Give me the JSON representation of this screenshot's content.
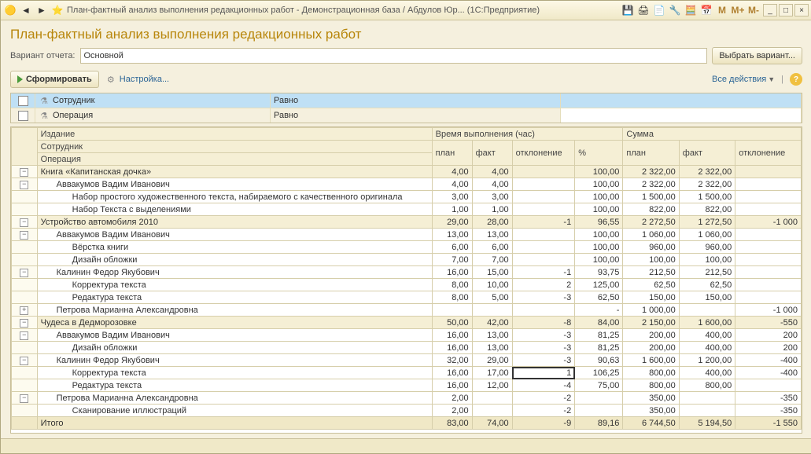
{
  "titlebar": {
    "title": "План-фактный анализ выполнения редакционных работ - Демонстрационная база / Абдулов Юр...  (1С:Предприятие)"
  },
  "page_title": "План-фактный анализ выполнения редакционных работ",
  "variant": {
    "label": "Вариант отчета:",
    "value": "Основной",
    "choose_btn": "Выбрать вариант..."
  },
  "toolbar": {
    "form": "Сформировать",
    "settings": "Настройка...",
    "all_actions": "Все действия"
  },
  "filters": [
    {
      "name": "Сотрудник",
      "op": "Равно",
      "selected": true
    },
    {
      "name": "Операция",
      "op": "Равно",
      "selected": false
    }
  ],
  "headers": {
    "group1": "Издание",
    "group2": "Сотрудник",
    "group3": "Операция",
    "time": "Время выполнения (час)",
    "sum": "Сумма",
    "plan": "план",
    "fact": "факт",
    "dev": "отклонение",
    "pct": "%"
  },
  "rows": [
    {
      "lvl": 0,
      "exp": "-",
      "label": "Книга «Капитанская дочка»",
      "p": "4,00",
      "f": "4,00",
      "d": "",
      "pc": "100,00",
      "sp": "2 322,00",
      "sf": "2 322,00",
      "sd": ""
    },
    {
      "lvl": 1,
      "exp": "-",
      "label": "Аввакумов Вадим Иванович",
      "p": "4,00",
      "f": "4,00",
      "d": "",
      "pc": "100,00",
      "sp": "2 322,00",
      "sf": "2 322,00",
      "sd": ""
    },
    {
      "lvl": 2,
      "exp": "",
      "label": "Набор простого художественного текста, набираемого с качественного оригинала",
      "p": "3,00",
      "f": "3,00",
      "d": "",
      "pc": "100,00",
      "sp": "1 500,00",
      "sf": "1 500,00",
      "sd": ""
    },
    {
      "lvl": 2,
      "exp": "",
      "label": "Набор Текста с выделениями",
      "p": "1,00",
      "f": "1,00",
      "d": "",
      "pc": "100,00",
      "sp": "822,00",
      "sf": "822,00",
      "sd": ""
    },
    {
      "lvl": 0,
      "exp": "-",
      "label": "Устройство автомобиля 2010",
      "p": "29,00",
      "f": "28,00",
      "d": "-1",
      "pc": "96,55",
      "sp": "2 272,50",
      "sf": "1 272,50",
      "sd": "-1 000"
    },
    {
      "lvl": 1,
      "exp": "-",
      "label": "Аввакумов Вадим Иванович",
      "p": "13,00",
      "f": "13,00",
      "d": "",
      "pc": "100,00",
      "sp": "1 060,00",
      "sf": "1 060,00",
      "sd": ""
    },
    {
      "lvl": 2,
      "exp": "",
      "label": "Вёрстка книги",
      "p": "6,00",
      "f": "6,00",
      "d": "",
      "pc": "100,00",
      "sp": "960,00",
      "sf": "960,00",
      "sd": ""
    },
    {
      "lvl": 2,
      "exp": "",
      "label": "Дизайн обложки",
      "p": "7,00",
      "f": "7,00",
      "d": "",
      "pc": "100,00",
      "sp": "100,00",
      "sf": "100,00",
      "sd": ""
    },
    {
      "lvl": 1,
      "exp": "-",
      "label": "Калинин Федор Якубович",
      "p": "16,00",
      "f": "15,00",
      "d": "-1",
      "pc": "93,75",
      "sp": "212,50",
      "sf": "212,50",
      "sd": ""
    },
    {
      "lvl": 2,
      "exp": "",
      "label": "Корректура текста",
      "p": "8,00",
      "f": "10,00",
      "d": "2",
      "pc": "125,00",
      "sp": "62,50",
      "sf": "62,50",
      "sd": ""
    },
    {
      "lvl": 2,
      "exp": "",
      "label": "Редактура текста",
      "p": "8,00",
      "f": "5,00",
      "d": "-3",
      "pc": "62,50",
      "sp": "150,00",
      "sf": "150,00",
      "sd": ""
    },
    {
      "lvl": 1,
      "exp": "+",
      "label": "Петрова Марианна Александровна",
      "p": "",
      "f": "",
      "d": "",
      "pc": "-",
      "sp": "1 000,00",
      "sf": "",
      "sd": "-1 000"
    },
    {
      "lvl": 0,
      "exp": "-",
      "label": "Чудеса в Дедморозовке",
      "p": "50,00",
      "f": "42,00",
      "d": "-8",
      "pc": "84,00",
      "sp": "2 150,00",
      "sf": "1 600,00",
      "sd": "-550"
    },
    {
      "lvl": 1,
      "exp": "-",
      "label": "Аввакумов Вадим Иванович",
      "p": "16,00",
      "f": "13,00",
      "d": "-3",
      "pc": "81,25",
      "sp": "200,00",
      "sf": "400,00",
      "sd": "200"
    },
    {
      "lvl": 2,
      "exp": "",
      "label": "Дизайн обложки",
      "p": "16,00",
      "f": "13,00",
      "d": "-3",
      "pc": "81,25",
      "sp": "200,00",
      "sf": "400,00",
      "sd": "200"
    },
    {
      "lvl": 1,
      "exp": "-",
      "label": "Калинин Федор Якубович",
      "p": "32,00",
      "f": "29,00",
      "d": "-3",
      "pc": "90,63",
      "sp": "1 600,00",
      "sf": "1 200,00",
      "sd": "-400"
    },
    {
      "lvl": 2,
      "exp": "",
      "label": "Корректура текста",
      "p": "16,00",
      "f": "17,00",
      "d": "1",
      "pc": "106,25",
      "sp": "800,00",
      "sf": "400,00",
      "sd": "-400",
      "sel": true
    },
    {
      "lvl": 2,
      "exp": "",
      "label": "Редактура текста",
      "p": "16,00",
      "f": "12,00",
      "d": "-4",
      "pc": "75,00",
      "sp": "800,00",
      "sf": "800,00",
      "sd": ""
    },
    {
      "lvl": 1,
      "exp": "-",
      "label": "Петрова Марианна Александровна",
      "p": "2,00",
      "f": "",
      "d": "-2",
      "pc": "",
      "sp": "350,00",
      "sf": "",
      "sd": "-350"
    },
    {
      "lvl": 2,
      "exp": "",
      "label": "Сканирование иллюстраций",
      "p": "2,00",
      "f": "",
      "d": "-2",
      "pc": "",
      "sp": "350,00",
      "sf": "",
      "sd": "-350"
    }
  ],
  "total": {
    "label": "Итого",
    "p": "83,00",
    "f": "74,00",
    "d": "-9",
    "pc": "89,16",
    "sp": "6 744,50",
    "sf": "5 194,50",
    "sd": "-1 550"
  }
}
